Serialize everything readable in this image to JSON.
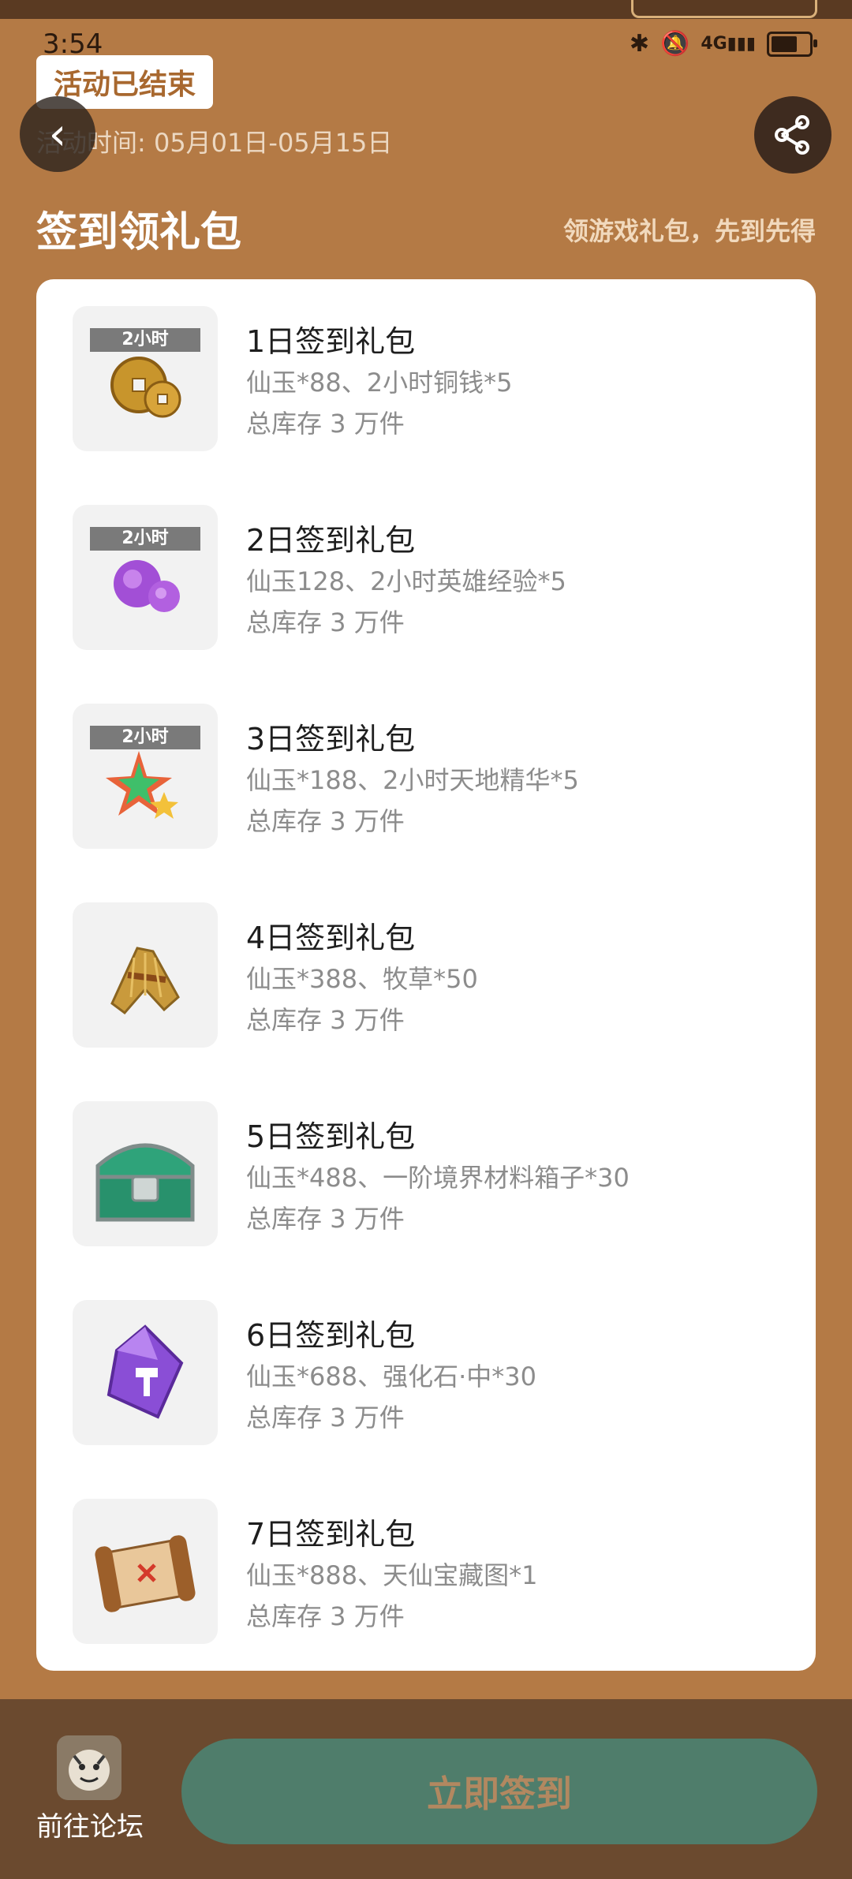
{
  "status_bar": {
    "time": "3:54",
    "battery_level": 0.62
  },
  "header": {
    "ended_badge": "活动已结束",
    "activity_time": "活动时间: 05月01日-05月15日"
  },
  "section": {
    "title": "签到领礼包",
    "subtitle": "领游戏礼包，先到先得"
  },
  "gifts": [
    {
      "title": "1日签到礼包",
      "desc": "仙玉*88、2小时铜钱*5",
      "stock": "总库存 3 万件",
      "tag": "2小时",
      "icon": "coins-icon"
    },
    {
      "title": "2日签到礼包",
      "desc": "仙玉128、2小时英雄经验*5",
      "stock": "总库存 3 万件",
      "tag": "2小时",
      "icon": "exp-orb-icon"
    },
    {
      "title": "3日签到礼包",
      "desc": "仙玉*188、2小时天地精华*5",
      "stock": "总库存 3 万件",
      "tag": "2小时",
      "icon": "star-essence-icon"
    },
    {
      "title": "4日签到礼包",
      "desc": "仙玉*388、牧草*50",
      "stock": "总库存 3 万件",
      "tag": "",
      "icon": "hay-icon"
    },
    {
      "title": "5日签到礼包",
      "desc": "仙玉*488、一阶境界材料箱子*30",
      "stock": "总库存 3 万件",
      "tag": "",
      "icon": "treasure-chest-icon"
    },
    {
      "title": "6日签到礼包",
      "desc": "仙玉*688、强化石·中*30",
      "stock": "总库存 3 万件",
      "tag": "",
      "icon": "enhance-stone-icon"
    },
    {
      "title": "7日签到礼包",
      "desc": "仙玉*888、天仙宝藏图*1",
      "stock": "总库存 3 万件",
      "tag": "",
      "icon": "treasure-map-icon"
    }
  ],
  "bottom": {
    "forum_label": "前往论坛",
    "checkin_label": "立即签到"
  },
  "colors": {
    "background": "#b47a45",
    "bottom_bar": "#6b4a2f",
    "checkin_button": "#4f7d6b",
    "badge_text": "#a8682f"
  }
}
